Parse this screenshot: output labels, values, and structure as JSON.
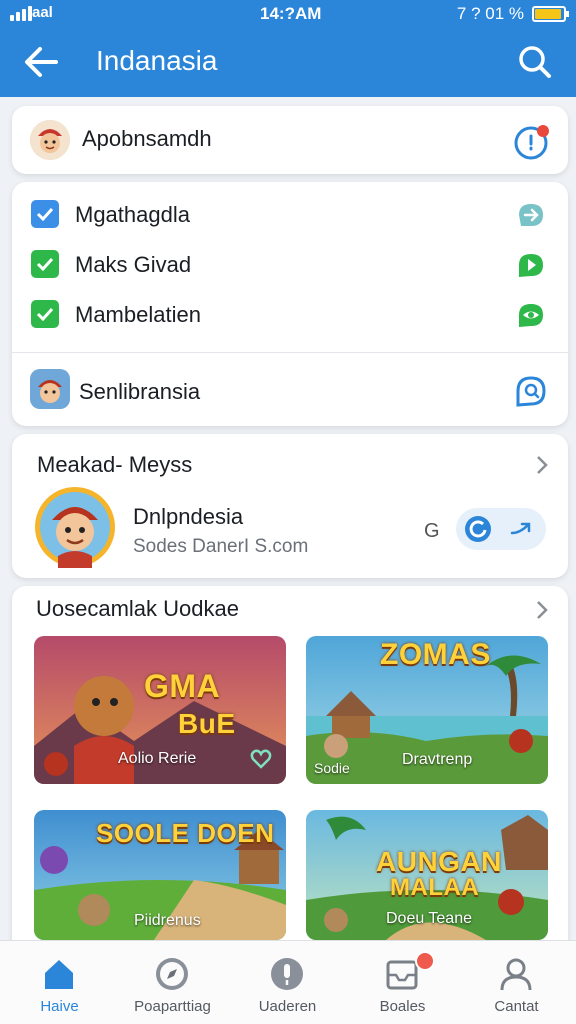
{
  "status_bar": {
    "signal_label": "aal",
    "time": "14:?AM",
    "right_text": "7 ? 01 %"
  },
  "header": {
    "title": "Indanasia",
    "back_icon": "arrow-left-icon",
    "search_icon": "search-icon"
  },
  "top_card": {
    "label": "Apobnsamdh",
    "action_icon": "notification-icon"
  },
  "checklist": {
    "items": [
      {
        "label": "Mgathagdla",
        "check_color": "#3b8fe6",
        "action_icon": "share-icon"
      },
      {
        "label": "Maks Givad",
        "check_color": "#2fb84a",
        "action_icon": "play-chat-icon"
      },
      {
        "label": "Mambelatien",
        "check_color": "#2fb84a",
        "action_icon": "eye-chat-icon"
      }
    ],
    "footer_label": "Senlibransia",
    "footer_icon": "chat-search-icon"
  },
  "messages": {
    "title": "Meakad- Meyss",
    "contact_name": "Dnlpndesia",
    "contact_sub": "Sodes DanerI S.com",
    "extra_glyph": "G"
  },
  "games": {
    "title": "Uosecamlak Uodkae",
    "tiles": [
      {
        "title_line1": "GMA",
        "title_line2": "BuE",
        "label": "Aolio Rerie"
      },
      {
        "title_line1": "ZOMAS",
        "title_line2": "",
        "label_left": "Sodie",
        "label": "Dravtrenp"
      },
      {
        "title_line1": "SOOLE DOEN",
        "title_line2": "",
        "label": "Piidrenus"
      },
      {
        "title_line1": "AUNGAN",
        "title_line2": "MALAA",
        "label": "Doeu Teane"
      }
    ]
  },
  "bottom_nav": {
    "items": [
      {
        "label": "Haive",
        "icon": "home-icon"
      },
      {
        "label": "Poaparttiag",
        "icon": "compass-icon"
      },
      {
        "label": "Uaderen",
        "icon": "microphone-icon"
      },
      {
        "label": "Boales",
        "icon": "inbox-icon"
      },
      {
        "label": "Cantat",
        "icon": "user-icon"
      }
    ]
  }
}
